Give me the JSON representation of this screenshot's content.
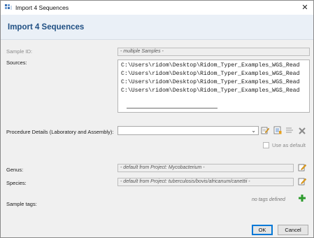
{
  "window": {
    "title": "Import 4 Sequences",
    "close_glyph": "✕"
  },
  "header": {
    "heading": "Import 4 Sequences"
  },
  "form": {
    "sample_id": {
      "label": "Sample ID:",
      "value": "- multiple Samples -"
    },
    "sources": {
      "label": "Sources:",
      "lines": [
        "C:\\Users\\ridom\\Desktop\\Ridom_Typer_Examples_WGS_Read",
        "C:\\Users\\ridom\\Desktop\\Ridom_Typer_Examples_WGS_Read",
        "C:\\Users\\ridom\\Desktop\\Ridom_Typer_Examples_WGS_Read",
        "C:\\Users\\ridom\\Desktop\\Ridom_Typer_Examples_WGS_Read"
      ]
    },
    "procedure": {
      "label": "Procedure Details (Laboratory and Assembly):",
      "selected_value": "",
      "use_as_default_label": "Use as default"
    },
    "genus": {
      "label": "Genus:",
      "value": "- default from Project: Mycobacterium -"
    },
    "species": {
      "label": "Species:",
      "value": "- default from Project: tuberculosis/bovis/africanum/canettii -"
    },
    "sample_tags": {
      "label": "Sample tags:",
      "empty_text": "no tags defined"
    }
  },
  "buttons": {
    "ok_label": "OK",
    "cancel_label": "Cancel"
  },
  "icons": {
    "app": "sequence-app-icon",
    "procedure_edit": "edit-document-icon",
    "procedure_manage": "manage-list-icon",
    "procedure_list": "list-icon",
    "procedure_clear": "clear-x-icon",
    "genus_edit": "edit-pencil-icon",
    "species_edit": "edit-pencil-icon",
    "tag_add": "add-plus-icon"
  },
  "colors": {
    "heading": "#1f4f83",
    "default_button_border": "#0078d7",
    "add_icon": "#2e9b2e"
  }
}
